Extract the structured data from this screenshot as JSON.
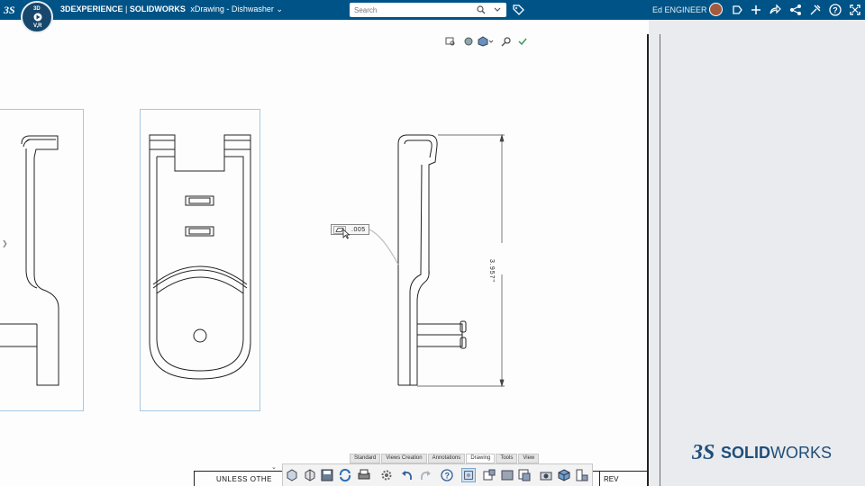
{
  "topbar": {
    "brand_bold": "3DEXPERIENCE",
    "brand_sep": " | ",
    "brand_app": "SOLIDWORKS",
    "document": "xDrawing - Dishwasher",
    "search_placeholder": "Search",
    "username": "Ed ENGINEER",
    "compass_labels": [
      "3D",
      "V,R"
    ]
  },
  "colors": {
    "topbar": "#005386",
    "view_frame": "#a6c9e2",
    "panel": "#e9ebee"
  },
  "drawing": {
    "tolerance_value": ".005",
    "dimension_value": "3.957\""
  },
  "command_manager": {
    "tabs": [
      "Standard",
      "Views Creation",
      "Annotations",
      "Drawing",
      "Tools",
      "View"
    ],
    "active_tab": "Drawing"
  },
  "title_block": {
    "note": "UNLESS OTHE",
    "rev": "REV"
  },
  "logo": {
    "text_bold": "SOLID",
    "text_rest": "WORKS"
  }
}
